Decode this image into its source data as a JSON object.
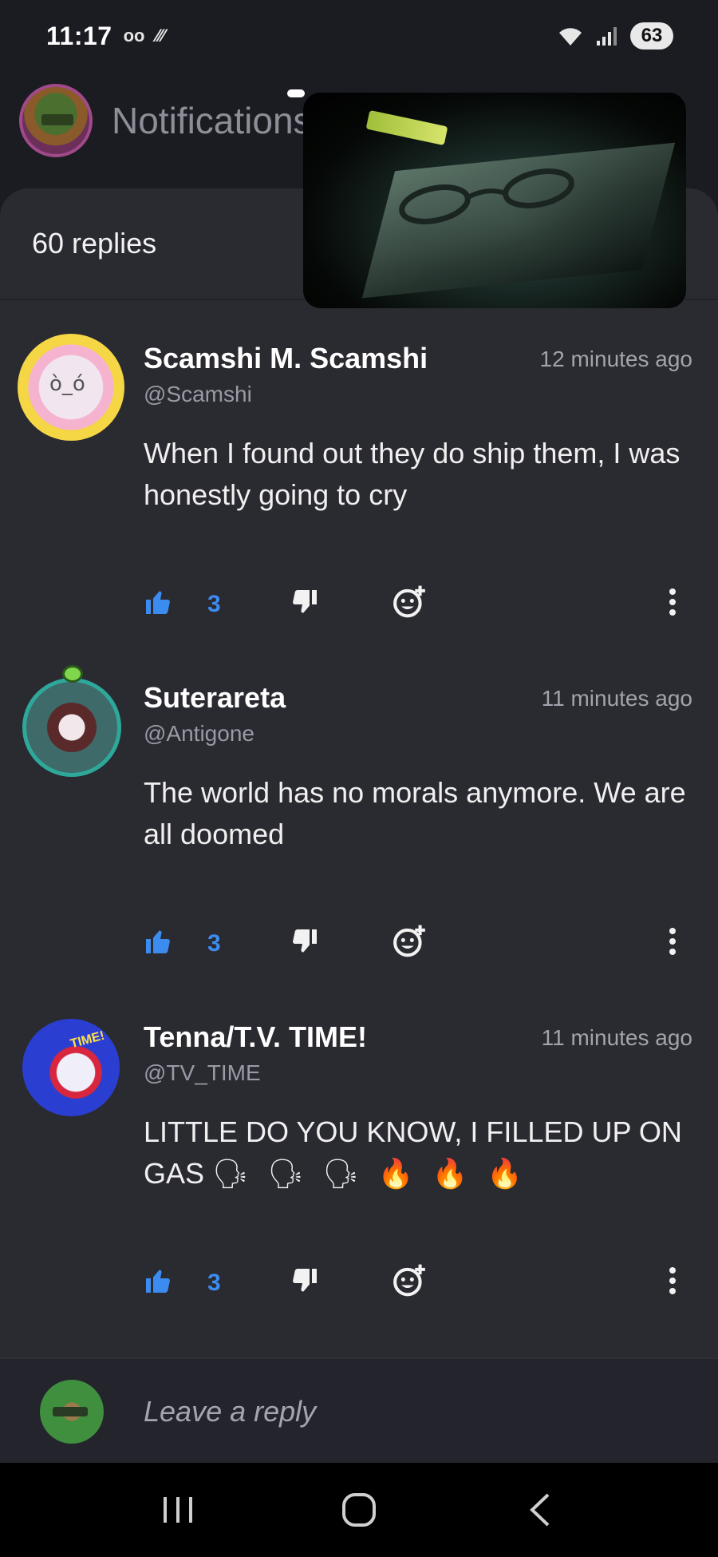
{
  "status_bar": {
    "time": "11:17",
    "voicemail_glyph": "oo",
    "extra_glyph": "⁄⁄⁄",
    "battery": "63",
    "icons": [
      "voicemail-icon",
      "signal-strength-icon",
      "wifi-icon",
      "cell-signal-icon",
      "battery-icon"
    ]
  },
  "header": {
    "title": "Notifications",
    "avatar": "user-avatar"
  },
  "sheet": {
    "replies_count": "60 replies"
  },
  "comments": [
    {
      "name": "Scamshi M. Scamshi",
      "handle": "@Scamshi",
      "time": "12 minutes ago",
      "text": "When I found out they do ship them, I was honestly going to cry",
      "likes": "3"
    },
    {
      "name": "Suterareta",
      "handle": "@Antigone",
      "time": "11 minutes ago",
      "text": "The world has no morals anymore. We are all doomed",
      "likes": "3"
    },
    {
      "name": "Tenna/T.V. TIME!",
      "handle": "@TV_TIME",
      "time": "11 minutes ago",
      "text": "LITTLE DO YOU KNOW, I FILLED UP ON GAS",
      "emoji": "🗣 🗣 🗣 🔥 🔥 🔥",
      "likes": "3"
    }
  ],
  "reply_bar": {
    "placeholder": "Leave a reply"
  },
  "colors": {
    "background": "#1b1b22",
    "sheet": "#2a2a31",
    "accent_like": "#3c8cf0",
    "text_muted": "#9a9aa6"
  },
  "nav_bar": {
    "icons": [
      "recent-apps-icon",
      "home-icon",
      "back-icon"
    ]
  }
}
